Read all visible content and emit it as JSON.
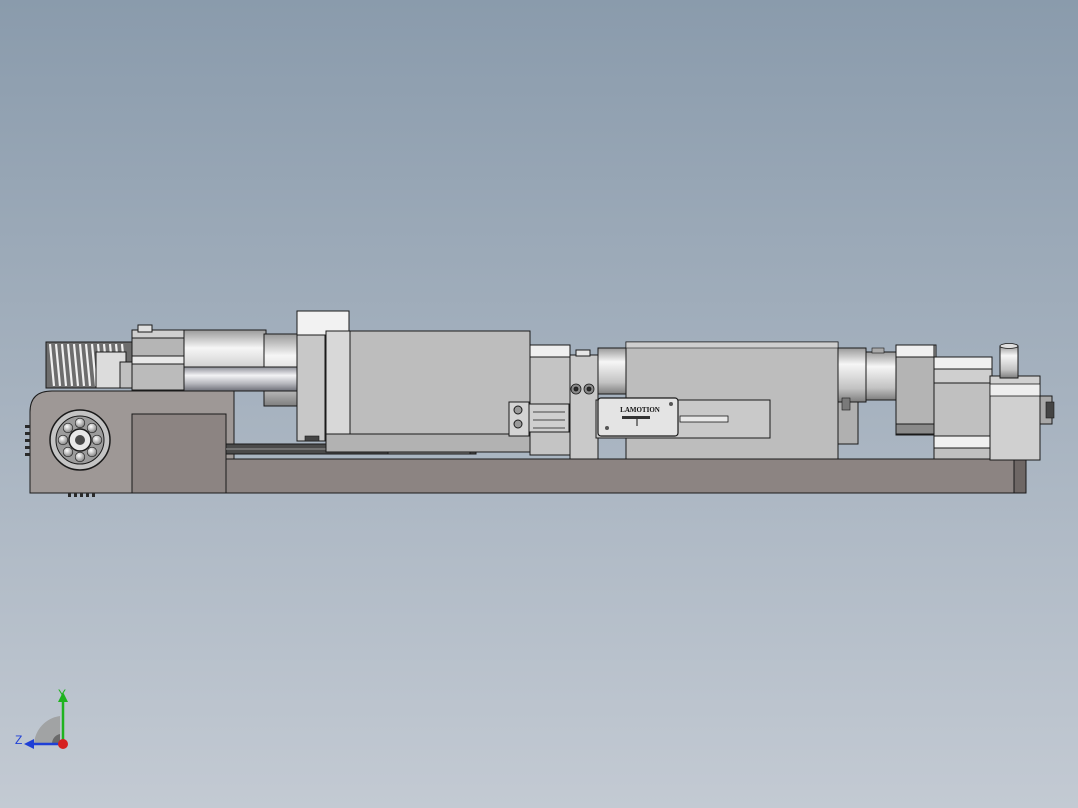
{
  "viewport": {
    "background_top": "#8a9bac",
    "background_bottom": "#c3cad3"
  },
  "model": {
    "nameplate": {
      "brand": "LAMOTION"
    },
    "colors": {
      "base": "#8c8482",
      "body": "#bdbdbd",
      "body_light": "#d6d6d6",
      "shaft": "#c8c8cc",
      "outline": "#1a1a1a"
    }
  },
  "triad": {
    "x_label": "Z",
    "y_label": "Y",
    "x_color": "#1f3fd6",
    "y_color": "#1fb31f",
    "origin_color": "#d61f1f"
  }
}
